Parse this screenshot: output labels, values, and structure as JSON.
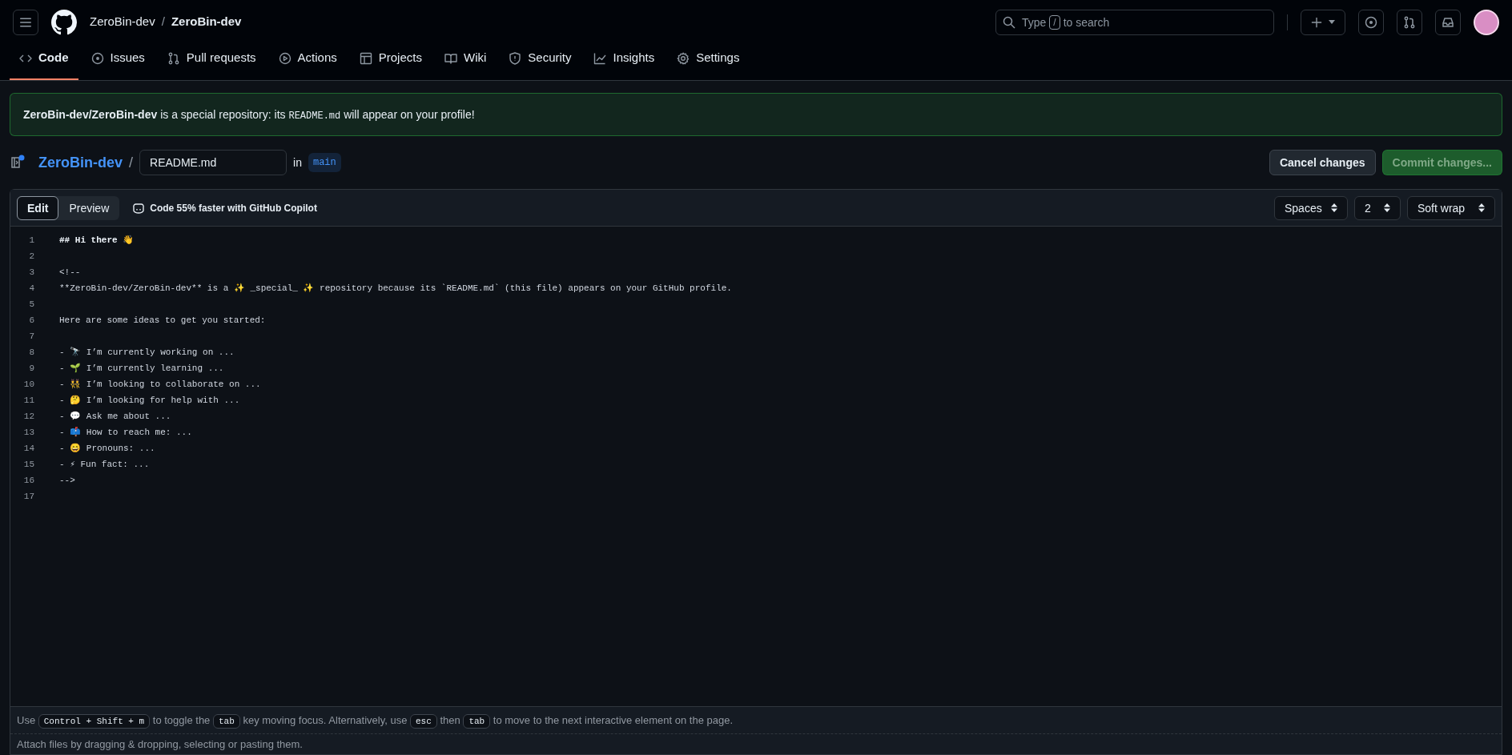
{
  "header": {
    "owner": "ZeroBin-dev",
    "separator": "/",
    "repo": "ZeroBin-dev",
    "search": {
      "before": "Type",
      "key": "/",
      "after": "to search"
    }
  },
  "tabs": [
    {
      "label": "Code",
      "selected": true
    },
    {
      "label": "Issues",
      "selected": false
    },
    {
      "label": "Pull requests",
      "selected": false
    },
    {
      "label": "Actions",
      "selected": false
    },
    {
      "label": "Projects",
      "selected": false
    },
    {
      "label": "Wiki",
      "selected": false
    },
    {
      "label": "Security",
      "selected": false
    },
    {
      "label": "Insights",
      "selected": false
    },
    {
      "label": "Settings",
      "selected": false
    }
  ],
  "banner": [
    {
      "kind": "bold",
      "text": "ZeroBin-dev/ZeroBin-dev"
    },
    {
      "kind": "text",
      "text": "is a special repository: its"
    },
    {
      "kind": "code",
      "text": "README.md"
    },
    {
      "kind": "text",
      "text": "will appear on your profile!"
    }
  ],
  "file_path": {
    "repo": "ZeroBin-dev",
    "separator": "/",
    "filename": "README.md",
    "in": "in",
    "branch": "main"
  },
  "actions": [
    {
      "label": "Cancel changes",
      "kind": "secondary"
    },
    {
      "label": "Commit changes...",
      "kind": "primary"
    }
  ],
  "editor_tabs": [
    {
      "label": "Edit",
      "selected": true
    },
    {
      "label": "Preview",
      "selected": false
    }
  ],
  "copilot": "Code 55% faster with GitHub Copilot",
  "selects": [
    {
      "value": "Spaces"
    },
    {
      "value": "2"
    },
    {
      "value": "Soft wrap"
    }
  ],
  "lines": [
    {
      "number": "1",
      "text": "## Hi there 👋",
      "kind": "heading"
    },
    {
      "number": "2"
    },
    {
      "number": "3",
      "text": "<!--",
      "kind": "text"
    },
    {
      "number": "4",
      "text": "**ZeroBin-dev/ZeroBin-dev** is a ✨ _special_ ✨ repository because its `README.md` (this file) appears on your GitHub profile.",
      "kind": "text"
    },
    {
      "number": "5"
    },
    {
      "number": "6",
      "text": "Here are some ideas to get you started:",
      "kind": "text"
    },
    {
      "number": "7"
    },
    {
      "number": "8",
      "text": "- 🔭 I’m currently working on ...",
      "kind": "text"
    },
    {
      "number": "9",
      "text": "- 🌱 I’m currently learning ...",
      "kind": "text"
    },
    {
      "number": "10",
      "text": "- 👯 I’m looking to collaborate on ...",
      "kind": "text"
    },
    {
      "number": "11",
      "text": "- 🤔 I’m looking for help with ...",
      "kind": "text"
    },
    {
      "number": "12",
      "text": "- 💬 Ask me about ...",
      "kind": "text"
    },
    {
      "number": "13",
      "text": "- 📫 How to reach me: ...",
      "kind": "text"
    },
    {
      "number": "14",
      "text": "- 😄 Pronouns: ...",
      "kind": "text"
    },
    {
      "number": "15",
      "text": "- ⚡ Fun fact: ...",
      "kind": "text"
    },
    {
      "number": "16",
      "text": "-->",
      "kind": "text"
    },
    {
      "number": "17"
    }
  ],
  "hint": [
    {
      "kind": "text",
      "text": "Use"
    },
    {
      "kind": "kbd",
      "text": "Control + Shift + m"
    },
    {
      "kind": "text",
      "text": "to toggle the"
    },
    {
      "kind": "kbd",
      "text": "tab"
    },
    {
      "kind": "text",
      "text": "key moving focus. Alternatively, use"
    },
    {
      "kind": "kbd",
      "text": "esc"
    },
    {
      "kind": "text",
      "text": "then"
    },
    {
      "kind": "kbd",
      "text": "tab"
    },
    {
      "kind": "text",
      "text": "to move to the next interactive element on the page."
    }
  ],
  "attach": "Attach files by dragging & dropping, selecting or pasting them."
}
